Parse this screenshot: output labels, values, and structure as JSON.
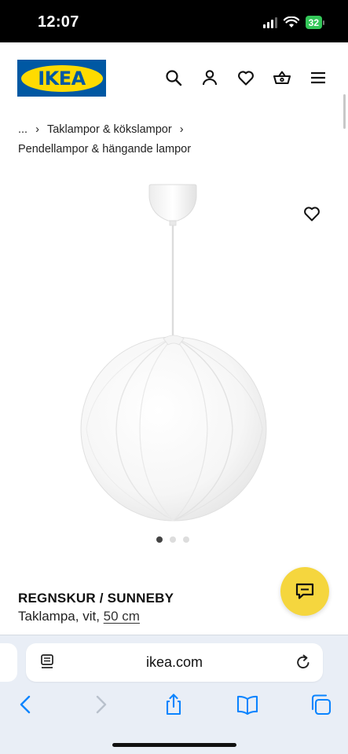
{
  "status_bar": {
    "time": "12:07",
    "battery": "32"
  },
  "header": {
    "logo_text": "IKEA",
    "icons": [
      "search-icon",
      "account-icon",
      "heart-icon",
      "basket-icon",
      "menu-icon"
    ]
  },
  "breadcrumb": {
    "ellipsis": "...",
    "separator": "›",
    "level1": "Taklampor & kökslampor",
    "level2": "Pendellampor & hängande lampor"
  },
  "product": {
    "name": "REGNSKUR / SUNNEBY",
    "description": "Taklampa, vit,",
    "size": "50 cm",
    "image_count": 3,
    "active_image_index": 0
  },
  "browser": {
    "url": "ikea.com",
    "toolbar_icons": [
      "back-icon",
      "forward-icon",
      "share-icon",
      "bookmarks-icon",
      "tabs-icon"
    ]
  },
  "colors": {
    "ikea_blue": "#0058a3",
    "ikea_yellow": "#ffdb00",
    "chat_yellow": "#f5d63e",
    "link_blue": "#0a84ff",
    "battery_green": "#34c759"
  }
}
